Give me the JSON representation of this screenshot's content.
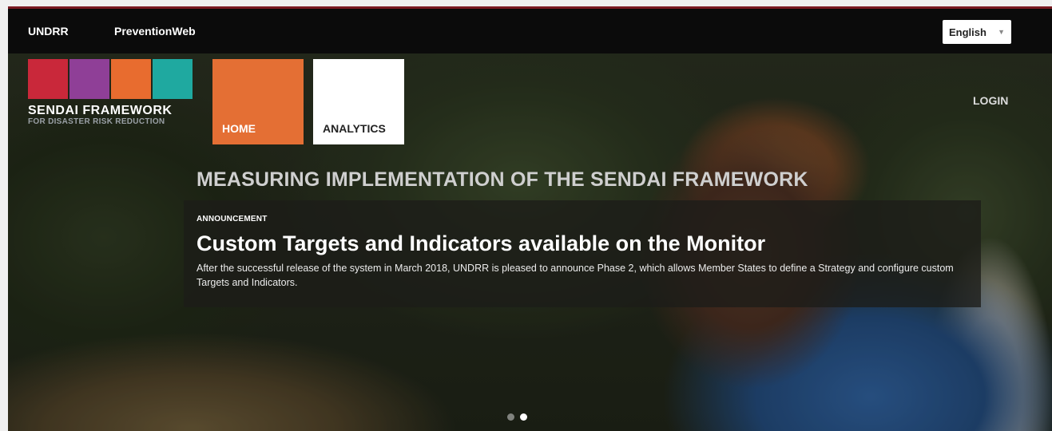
{
  "topbar": {
    "link_undrr": "UNDRR",
    "link_preventionweb": "PreventionWeb",
    "language": "English"
  },
  "logo": {
    "title": "SENDAI FRAMEWORK",
    "subtitle": "FOR DISASTER RISK REDUCTION",
    "colors": [
      "#c9283a",
      "#8f3f97",
      "#e86c2f",
      "#1fa9a0"
    ]
  },
  "nav": {
    "home": "HOME",
    "analytics": "ANALYTICS",
    "login": "LOGIN",
    "active_color": "#e46f34"
  },
  "hero": {
    "headline": "MEASURING IMPLEMENTATION OF THE SENDAI FRAMEWORK",
    "announcement_label": "ANNOUNCEMENT",
    "announcement_title": "Custom Targets and Indicators available on the Monitor",
    "announcement_text": "After the successful release of the system in March 2018, UNDRR is pleased to announce Phase 2, which allows Member States to define a Strategy and configure custom Targets and Indicators."
  },
  "carousel": {
    "slides": 2,
    "active_slide": 2
  }
}
